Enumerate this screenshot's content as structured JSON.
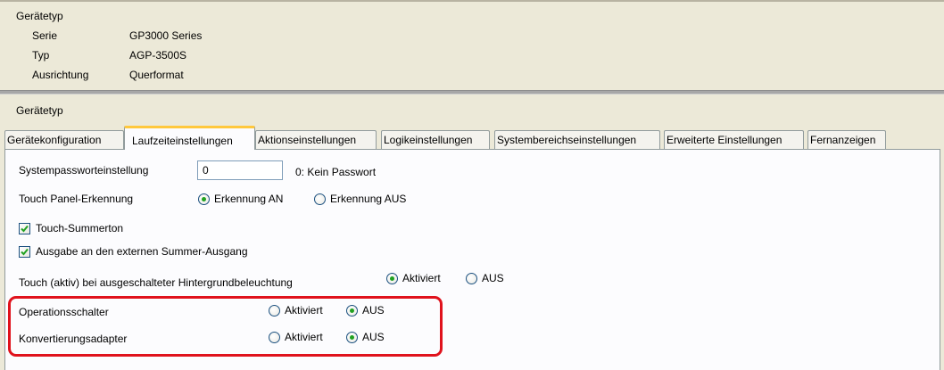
{
  "device_panel": {
    "title": "Gerätetyp",
    "rows": [
      {
        "label": "Serie",
        "value": "GP3000 Series"
      },
      {
        "label": "Typ",
        "value": "AGP-3500S"
      },
      {
        "label": "Ausrichtung",
        "value": "Querformat"
      }
    ]
  },
  "main_title": "Gerätetyp",
  "tabs": [
    {
      "label": "Gerätekonfiguration",
      "active": false
    },
    {
      "label": "Laufzeiteinstellungen",
      "active": true
    },
    {
      "label": "Aktionseinstellungen",
      "active": false
    },
    {
      "label": "Logikeinstellungen",
      "active": false
    },
    {
      "label": "Systembereichseinstellungen",
      "active": false
    },
    {
      "label": "Erweiterte Einstellungen",
      "active": false
    },
    {
      "label": "Fernanzeigen",
      "active": false
    }
  ],
  "settings": {
    "password": {
      "label": "Systempassworteinstellung",
      "value": "0",
      "hint": "0: Kein Passwort"
    },
    "touch_detect": {
      "label": "Touch Panel-Erkennung",
      "on_label": "Erkennung AN",
      "off_label": "Erkennung AUS",
      "selected": "on"
    },
    "buzzer": {
      "label": "Touch-Summerton",
      "checked": true
    },
    "external_buzzer": {
      "label": "Ausgabe an den externen Summer-Ausgang",
      "checked": true
    },
    "backlight_touch": {
      "label": "Touch (aktiv) bei ausgeschalteter Hintergrundbeleuchtung",
      "on_label": "Aktiviert",
      "off_label": "AUS",
      "selected": "on"
    },
    "operation_switch": {
      "label": "Operationsschalter",
      "on_label": "Aktiviert",
      "off_label": "AUS",
      "selected": "off"
    },
    "conversion_adapter": {
      "label": "Konvertierungsadapter",
      "on_label": "Aktiviert",
      "off_label": "AUS",
      "selected": "off"
    }
  },
  "colors": {
    "highlight": "#e0121c",
    "active_tab_accent": "#ffc83c",
    "radio_dot": "#21a121"
  }
}
